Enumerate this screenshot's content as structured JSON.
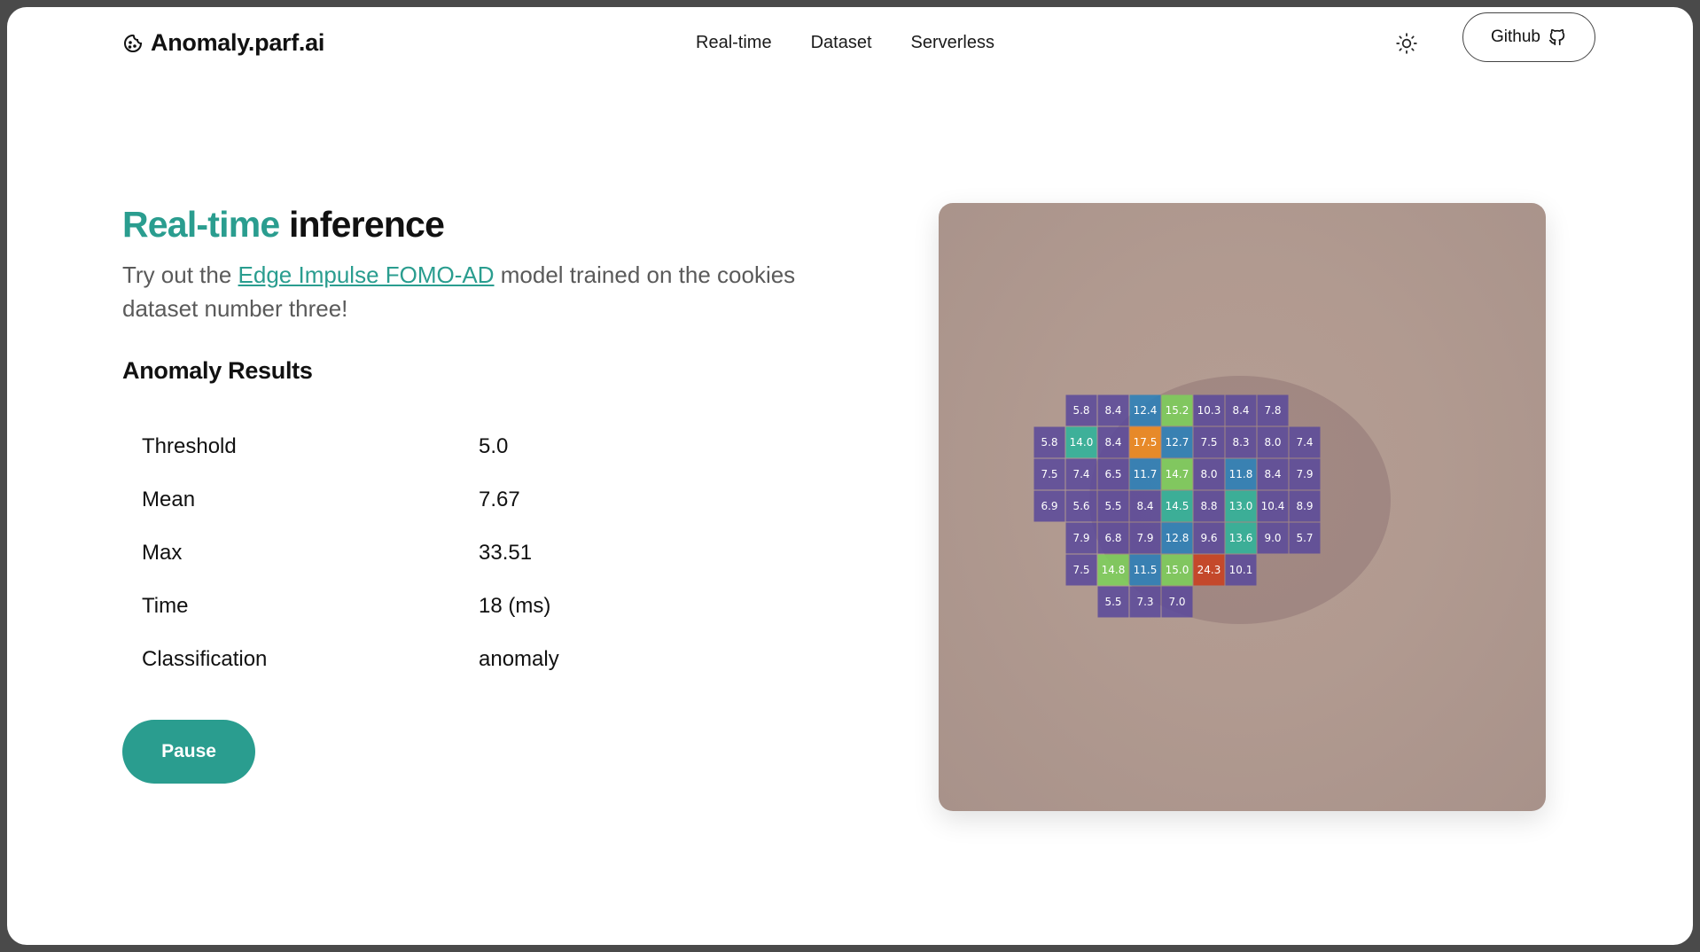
{
  "header": {
    "brand": "Anomaly.parf.ai",
    "nav": [
      "Real-time",
      "Dataset",
      "Serverless"
    ],
    "github_label": "Github"
  },
  "main": {
    "title_accent": "Real-time",
    "title_rest": "inference",
    "subtitle_before": "Try out the ",
    "subtitle_link": "Edge Impulse FOMO-AD",
    "subtitle_after": " model trained on the cookies dataset number three!",
    "results_title": "Anomaly Results",
    "results": [
      {
        "label": "Threshold",
        "value": "5.0"
      },
      {
        "label": "Mean",
        "value": "7.67"
      },
      {
        "label": "Max",
        "value": "33.51"
      },
      {
        "label": "Time",
        "value": "18 (ms)"
      },
      {
        "label": "Classification",
        "value": "anomaly"
      }
    ],
    "pause_label": "Pause"
  },
  "heatmap": {
    "rows": [
      {
        "start": 1,
        "values": [
          "5.8",
          "8.4",
          "12.4",
          "15.2",
          "10.3",
          "8.4",
          "7.8"
        ]
      },
      {
        "start": 0,
        "values": [
          "5.8",
          "14.0",
          "8.4",
          "17.5",
          "12.7",
          "7.5",
          "8.3",
          "8.0",
          "7.4"
        ]
      },
      {
        "start": 0,
        "values": [
          "7.5",
          "7.4",
          "6.5",
          "11.7",
          "14.7",
          "8.0",
          "11.8",
          "8.4",
          "7.9"
        ]
      },
      {
        "start": 0,
        "values": [
          "6.9",
          "5.6",
          "5.5",
          "8.4",
          "14.5",
          "8.8",
          "13.0",
          "10.4",
          "8.9"
        ]
      },
      {
        "start": 1,
        "values": [
          "7.9",
          "6.8",
          "7.9",
          "12.8",
          "9.6",
          "13.6",
          "9.0",
          "5.7"
        ]
      },
      {
        "start": 1,
        "values": [
          "7.5",
          "14.8",
          "11.5",
          "15.0",
          "24.3",
          "10.1"
        ]
      },
      {
        "start": 2,
        "values": [
          "5.5",
          "7.3",
          "7.0"
        ]
      }
    ],
    "colors": {
      "low": "#5b4a9a",
      "mid": "#2a7fb8",
      "teal": "#2db39a",
      "green": "#7ccf5a",
      "orange": "#f08a1c",
      "red": "#c8401f"
    }
  }
}
